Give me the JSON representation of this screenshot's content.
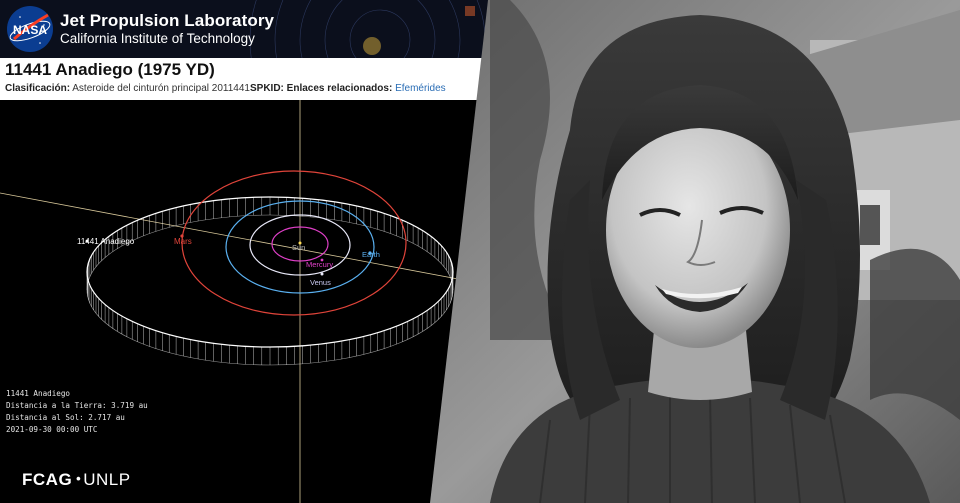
{
  "header": {
    "org_title": "Jet Propulsion Laboratory",
    "org_subtitle": "California Institute of Technology",
    "logo_text": "NASA"
  },
  "object": {
    "title": "11441 Anadiego (1975 YD)",
    "class_label": "Clasificación:",
    "class_value": "Asteroide del cinturón principal 2011441",
    "spkid_label": "SPKID:",
    "related_label": "Enlaces relacionados:",
    "related_link": "Efemérides"
  },
  "orbit_labels": {
    "asteroid": "11441 Anadiego",
    "mars": "Mars",
    "sun": "Sun",
    "mercury": "Mercury",
    "venus": "Venus",
    "earth": "Earth"
  },
  "readout": {
    "name": "11441 Anadiego",
    "earth_distance": "Distancia a la Tierra: 3.719 au",
    "sun_distance": "Distancia al Sol: 2.717 au",
    "datetime": "2021-09-30 00:00 UTC"
  },
  "credit": {
    "left": "FCAG",
    "sep": "•",
    "right": "UNLP"
  },
  "colors": {
    "mars_orbit": "#e0443a",
    "earth_orbit": "#5ab0f0",
    "venus_orbit": "#e8e8f8",
    "mercury_orbit": "#e040c8",
    "asteroid_orbit": "#ffffff",
    "ecliptic_line": "#d8c89a"
  },
  "photo": {
    "description_icon": "portrait-photo"
  }
}
